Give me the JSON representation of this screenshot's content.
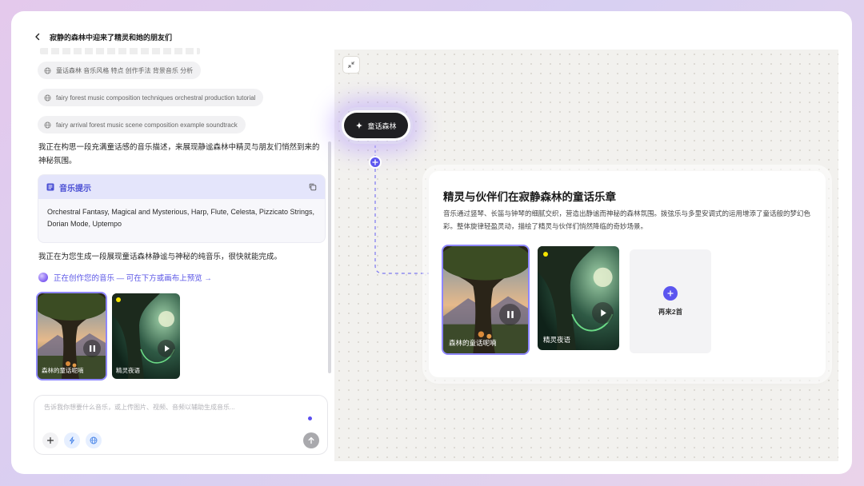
{
  "header": {
    "title": "寂静的森林中迎来了精灵和她的朋友们"
  },
  "chat": {
    "search_chips": [
      "童话森林 音乐风格 特点 创作手法 背景音乐 分析",
      "fairy forest music composition techniques orchestral production tutorial",
      "fairy arrival forest music scene composition example soundtrack"
    ],
    "message_1": "我正在构思一段充满童话感的音乐描述，来展现静谧森林中精灵与朋友们悄然到来的神秘氛围。",
    "prompt_card": {
      "title": "音乐提示",
      "text": "Orchestral Fantasy, Magical and Mysterious, Harp, Flute, Celesta, Pizzicato Strings, Dorian Mode, Uptempo"
    },
    "message_2": "我正在为您生成一段展现童话森林静谧与神秘的纯音乐，很快就能完成。",
    "status": "正在创作您的音乐 — 可在下方或画布上预览 →",
    "tracks": [
      {
        "title": "森林的童话呢喃",
        "state": "playing"
      },
      {
        "title": "精灵夜语",
        "state": "paused"
      }
    ]
  },
  "composer": {
    "placeholder": "告诉我你想要什么音乐，或上传图片、视频、音频以辅助生成音乐..."
  },
  "canvas": {
    "node_label": "童话森林",
    "card": {
      "title": "精灵与伙伴们在寂静森林的童话乐章",
      "description": "音乐通过竖琴、长笛与钟琴的细腻交织，营造出静谧而神秘的森林氛围。拨弦乐与多里安调式的运用增添了童话般的梦幻色彩。整体旋律轻盈灵动，描绘了精灵与伙伴们悄然降临的奇妙场景。",
      "tracks": [
        {
          "title": "森林的童话呢喃",
          "state": "playing"
        },
        {
          "title": "精灵夜语",
          "state": "paused"
        }
      ],
      "more_label": "再来2首"
    }
  },
  "colors": {
    "accent": "#5b55ef",
    "selected_outline": "#8e87ff",
    "indicator": "#f5e400"
  },
  "icons": [
    "chevron-left-icon",
    "globe-icon",
    "list-icon",
    "copy-icon",
    "plus-icon",
    "lightning-icon",
    "send-arrow-icon",
    "collapse-icon",
    "sparkle-icon",
    "pause-icon",
    "play-icon"
  ]
}
